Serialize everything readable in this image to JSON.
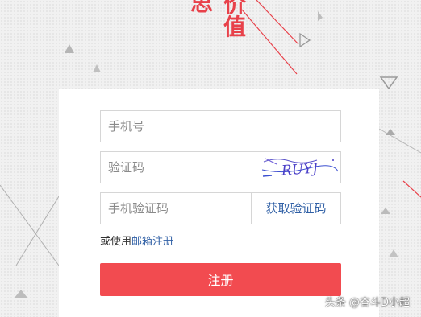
{
  "banner": {
    "char_left": "思",
    "char_right_1": "价",
    "char_right_2": "值"
  },
  "form": {
    "phone_placeholder": "手机号",
    "captcha_placeholder": "验证码",
    "captcha_text": "RUYJ",
    "sms_code_placeholder": "手机验证码",
    "get_code_label": "获取验证码",
    "alt_prefix": "或使用",
    "alt_link": "邮箱注册",
    "submit_label": "注册"
  },
  "watermark": "头条 @奋斗D小超",
  "colors": {
    "accent_red": "#f24b50",
    "link_blue": "#2f5fa5"
  }
}
